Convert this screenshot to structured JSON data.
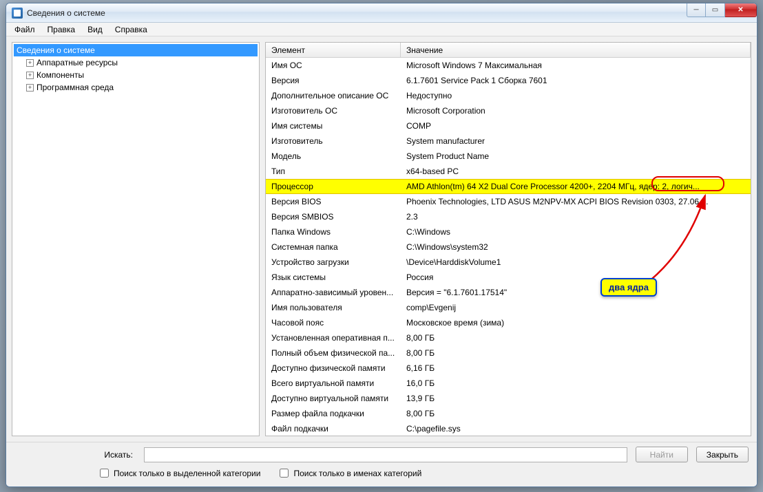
{
  "window": {
    "title": "Сведения о системе"
  },
  "menu": {
    "file": "Файл",
    "edit": "Правка",
    "view": "Вид",
    "help": "Справка"
  },
  "tree": {
    "root": "Сведения о системе",
    "items": [
      "Аппаратные ресурсы",
      "Компоненты",
      "Программная среда"
    ]
  },
  "columns": {
    "element": "Элемент",
    "value": "Значение"
  },
  "rows": [
    {
      "element": "Имя ОС",
      "value": "Microsoft Windows 7 Максимальная"
    },
    {
      "element": "Версия",
      "value": "6.1.7601 Service Pack 1 Сборка 7601"
    },
    {
      "element": "Дополнительное описание ОС",
      "value": "Недоступно"
    },
    {
      "element": "Изготовитель ОС",
      "value": "Microsoft Corporation"
    },
    {
      "element": "Имя системы",
      "value": "COMP"
    },
    {
      "element": "Изготовитель",
      "value": "System manufacturer"
    },
    {
      "element": "Модель",
      "value": "System Product Name"
    },
    {
      "element": "Тип",
      "value": "x64-based PC"
    },
    {
      "element": "Процессор",
      "value": "AMD Athlon(tm) 64 X2 Dual Core Processor 4200+, 2204 МГц, ядер: 2, логич...",
      "highlight": true
    },
    {
      "element": "Версия BIOS",
      "value": "Phoenix Technologies, LTD ASUS M2NPV-MX ACPI BIOS Revision 0303, 27.06...."
    },
    {
      "element": "Версия SMBIOS",
      "value": "2.3"
    },
    {
      "element": "Папка Windows",
      "value": "C:\\Windows"
    },
    {
      "element": "Системная папка",
      "value": "C:\\Windows\\system32"
    },
    {
      "element": "Устройство загрузки",
      "value": "\\Device\\HarddiskVolume1"
    },
    {
      "element": "Язык системы",
      "value": "Россия"
    },
    {
      "element": "Аппаратно-зависимый уровен...",
      "value": "Версия = \"6.1.7601.17514\""
    },
    {
      "element": "Имя пользователя",
      "value": "comp\\Evgenij"
    },
    {
      "element": "Часовой пояс",
      "value": "Московское время (зима)"
    },
    {
      "element": "Установленная оперативная п...",
      "value": "8,00 ГБ"
    },
    {
      "element": "Полный объем физической па...",
      "value": "8,00 ГБ"
    },
    {
      "element": "Доступно физической памяти",
      "value": "6,16 ГБ"
    },
    {
      "element": "Всего виртуальной памяти",
      "value": "16,0 ГБ"
    },
    {
      "element": "Доступно виртуальной памяти",
      "value": "13,9 ГБ"
    },
    {
      "element": "Размер файла подкачки",
      "value": "8,00 ГБ"
    },
    {
      "element": "Файл подкачки",
      "value": "C:\\pagefile.sys"
    }
  ],
  "footer": {
    "search_label": "Искать:",
    "find": "Найти",
    "close": "Закрыть",
    "check1": "Поиск только в выделенной категории",
    "check2": "Поиск только в именах категорий"
  },
  "annotation": {
    "callout": "два ядра"
  }
}
